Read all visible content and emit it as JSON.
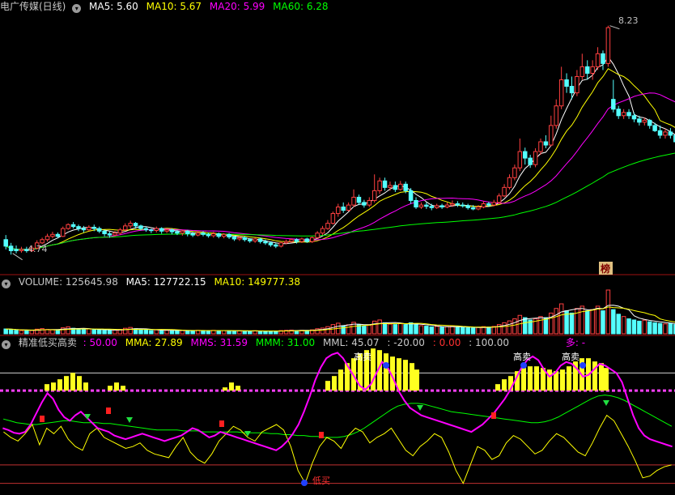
{
  "title": "电广传媒(日线)",
  "ma_header": {
    "ma5": "MA5: 5.60",
    "ma10": "MA10: 5.67",
    "ma20": "MA20: 5.99",
    "ma60": "MA60: 6.28"
  },
  "price_labels": {
    "high": "8.23",
    "low": "4.74",
    "badge": "榜"
  },
  "volume_header": {
    "volume": "VOLUME: 125645.98",
    "ma5": "MA5: 127722.15",
    "ma10": "MA10: 149777.38"
  },
  "indicator_header": {
    "name": "精准低买高卖",
    "v1": ": 50.00",
    "mma": "MMA: 27.89",
    "mms": "MMS: 31.59",
    "mmm": "MMM: 31.00",
    "mml": "MML: 45.07",
    "v2": ": -20.00",
    "v3": ": 0.00",
    "v4": ": 100.00",
    "duo": "多: -"
  },
  "signal_labels": {
    "low_buy": "低买",
    "high_sell": "高卖"
  },
  "colors": {
    "up": "#ff4040",
    "down": "#54ffff",
    "ma5": "#ffffff",
    "ma10": "#ffff00",
    "ma20": "#ff00ff",
    "ma60": "#00ff00",
    "mma": "#ffff00",
    "mms": "#ff00ff",
    "mmm": "#00ff00",
    "separator": "#a01010",
    "text_gray": "#c0c0c0"
  },
  "chart_data": {
    "type": "candlestick",
    "symbol": "电广传媒",
    "period": "日线",
    "price_range": [
      4.5,
      8.4
    ],
    "high_mark": 8.23,
    "low_mark": 4.74,
    "candles": [
      [
        4.95,
        4.85,
        5.02,
        4.8
      ],
      [
        4.85,
        4.78,
        4.9,
        4.72
      ],
      [
        4.8,
        4.78,
        4.86,
        4.74
      ],
      [
        4.78,
        4.8,
        4.84,
        4.75
      ],
      [
        4.8,
        4.78,
        4.84,
        4.75
      ],
      [
        4.78,
        4.82,
        4.86,
        4.76
      ],
      [
        4.82,
        4.9,
        4.94,
        4.8
      ],
      [
        4.9,
        4.95,
        4.98,
        4.88
      ],
      [
        4.95,
        5.0,
        5.04,
        4.92
      ],
      [
        5.0,
        5.03,
        5.07,
        4.97
      ],
      [
        5.03,
        5.0,
        5.06,
        4.97
      ],
      [
        5.0,
        5.12,
        5.15,
        4.99
      ],
      [
        5.12,
        5.18,
        5.2,
        5.1
      ],
      [
        5.18,
        5.15,
        5.22,
        5.12
      ],
      [
        5.15,
        5.12,
        5.18,
        5.08
      ],
      [
        5.12,
        5.1,
        5.16,
        5.06
      ],
      [
        5.1,
        5.14,
        5.17,
        5.08
      ],
      [
        5.14,
        5.12,
        5.18,
        5.08
      ],
      [
        5.12,
        5.08,
        5.15,
        5.05
      ],
      [
        5.08,
        5.04,
        5.1,
        5.0
      ],
      [
        5.04,
        5.02,
        5.07,
        4.98
      ],
      [
        5.02,
        5.05,
        5.08,
        5.0
      ],
      [
        5.05,
        5.1,
        5.13,
        5.02
      ],
      [
        5.1,
        5.16,
        5.2,
        5.08
      ],
      [
        5.16,
        5.2,
        5.24,
        5.12
      ],
      [
        5.2,
        5.16,
        5.22,
        5.12
      ],
      [
        5.16,
        5.12,
        5.18,
        5.09
      ],
      [
        5.12,
        5.1,
        5.15,
        5.07
      ],
      [
        5.1,
        5.09,
        5.12,
        5.05
      ],
      [
        5.09,
        5.12,
        5.15,
        5.06
      ],
      [
        5.12,
        5.08,
        5.14,
        5.04
      ],
      [
        5.08,
        5.1,
        5.12,
        5.05
      ],
      [
        5.1,
        5.07,
        5.12,
        5.03
      ],
      [
        5.07,
        5.05,
        5.1,
        5.02
      ],
      [
        5.05,
        5.08,
        5.1,
        5.01
      ],
      [
        5.08,
        5.04,
        5.1,
        5.0
      ],
      [
        5.04,
        5.02,
        5.07,
        4.99
      ],
      [
        5.02,
        5.05,
        5.08,
        5.0
      ],
      [
        5.05,
        5.03,
        5.08,
        5.0
      ],
      [
        5.03,
        5.01,
        5.06,
        4.98
      ],
      [
        5.01,
        5.04,
        5.07,
        4.98
      ],
      [
        5.04,
        5.0,
        5.06,
        4.97
      ],
      [
        5.0,
        5.03,
        5.05,
        4.97
      ],
      [
        5.03,
        4.99,
        5.05,
        4.96
      ],
      [
        4.99,
        4.96,
        5.01,
        4.93
      ],
      [
        4.96,
        4.98,
        5.0,
        4.93
      ],
      [
        4.98,
        4.95,
        5.0,
        4.92
      ],
      [
        4.95,
        4.93,
        4.97,
        4.9
      ],
      [
        4.93,
        4.96,
        4.98,
        4.9
      ],
      [
        4.96,
        4.92,
        4.98,
        4.89
      ],
      [
        4.92,
        4.9,
        4.95,
        4.87
      ],
      [
        4.9,
        4.87,
        4.92,
        4.84
      ],
      [
        4.87,
        4.85,
        4.9,
        4.82
      ],
      [
        4.85,
        4.9,
        4.92,
        4.83
      ],
      [
        4.9,
        4.92,
        4.95,
        4.88
      ],
      [
        4.92,
        4.95,
        4.97,
        4.9
      ],
      [
        4.95,
        4.92,
        4.97,
        4.89
      ],
      [
        4.92,
        4.96,
        4.98,
        4.9
      ],
      [
        4.96,
        4.92,
        4.98,
        4.9
      ],
      [
        4.92,
        4.98,
        5.0,
        4.9
      ],
      [
        4.98,
        5.05,
        5.08,
        4.96
      ],
      [
        5.05,
        5.12,
        5.16,
        5.02
      ],
      [
        5.12,
        5.2,
        5.25,
        5.1
      ],
      [
        5.2,
        5.35,
        5.38,
        5.18
      ],
      [
        5.35,
        5.45,
        5.5,
        5.3
      ],
      [
        5.45,
        5.4,
        5.52,
        5.36
      ],
      [
        5.4,
        5.48,
        5.52,
        5.38
      ],
      [
        5.48,
        5.6,
        5.72,
        5.45
      ],
      [
        5.6,
        5.52,
        5.64,
        5.48
      ],
      [
        5.52,
        5.48,
        5.56,
        5.44
      ],
      [
        5.48,
        5.55,
        5.6,
        5.45
      ],
      [
        5.55,
        5.7,
        5.95,
        5.52
      ],
      [
        5.7,
        5.85,
        5.9,
        5.65
      ],
      [
        5.85,
        5.75,
        5.9,
        5.7
      ],
      [
        5.75,
        5.78,
        5.84,
        5.7
      ],
      [
        5.78,
        5.72,
        5.84,
        5.68
      ],
      [
        5.72,
        5.8,
        5.85,
        5.7
      ],
      [
        5.8,
        5.7,
        5.84,
        5.66
      ],
      [
        5.7,
        5.55,
        5.74,
        5.5
      ],
      [
        5.55,
        5.45,
        5.6,
        5.42
      ],
      [
        5.45,
        5.48,
        5.52,
        5.42
      ],
      [
        5.48,
        5.46,
        5.52,
        5.42
      ],
      [
        5.46,
        5.44,
        5.5,
        5.4
      ],
      [
        5.44,
        5.47,
        5.5,
        5.42
      ],
      [
        5.47,
        5.45,
        5.5,
        5.42
      ],
      [
        5.45,
        5.48,
        5.52,
        5.43
      ],
      [
        5.48,
        5.5,
        5.55,
        5.45
      ],
      [
        5.5,
        5.48,
        5.54,
        5.45
      ],
      [
        5.48,
        5.47,
        5.52,
        5.44
      ],
      [
        5.47,
        5.44,
        5.5,
        5.41
      ],
      [
        5.44,
        5.42,
        5.48,
        5.4
      ],
      [
        5.42,
        5.45,
        5.48,
        5.4
      ],
      [
        5.45,
        5.5,
        5.54,
        5.43
      ],
      [
        5.5,
        5.48,
        5.53,
        5.45
      ],
      [
        5.48,
        5.52,
        5.56,
        5.46
      ],
      [
        5.52,
        5.62,
        5.66,
        5.5
      ],
      [
        5.62,
        5.75,
        5.8,
        5.6
      ],
      [
        5.75,
        5.9,
        5.95,
        5.72
      ],
      [
        5.9,
        6.05,
        6.1,
        5.86
      ],
      [
        6.05,
        6.3,
        6.5,
        6.0
      ],
      [
        6.3,
        6.2,
        6.36,
        6.1
      ],
      [
        6.2,
        6.1,
        6.25,
        6.05
      ],
      [
        6.1,
        6.3,
        6.35,
        6.06
      ],
      [
        6.3,
        6.45,
        6.5,
        6.25
      ],
      [
        6.45,
        6.4,
        6.55,
        6.35
      ],
      [
        6.4,
        6.7,
        6.85,
        6.38
      ],
      [
        6.7,
        7.0,
        7.1,
        6.65
      ],
      [
        7.0,
        7.4,
        7.6,
        6.95
      ],
      [
        7.4,
        7.3,
        7.5,
        7.2
      ],
      [
        7.3,
        7.2,
        7.45,
        7.1
      ],
      [
        7.2,
        7.45,
        7.55,
        7.15
      ],
      [
        7.45,
        7.6,
        7.8,
        7.4
      ],
      [
        7.6,
        7.5,
        7.7,
        7.4
      ],
      [
        7.5,
        7.6,
        7.7,
        7.4
      ],
      [
        7.6,
        7.8,
        7.9,
        7.55
      ],
      [
        7.8,
        7.65,
        7.85,
        7.55
      ],
      [
        7.65,
        8.2,
        8.23,
        7.6
      ],
      [
        7.1,
        6.95,
        7.4,
        6.9
      ],
      [
        6.95,
        6.85,
        7.0,
        6.8
      ],
      [
        6.85,
        6.9,
        6.95,
        6.8
      ],
      [
        6.9,
        6.85,
        6.95,
        6.8
      ],
      [
        6.85,
        6.8,
        6.9,
        6.75
      ],
      [
        6.8,
        6.75,
        6.85,
        6.7
      ],
      [
        6.75,
        6.78,
        6.82,
        6.7
      ],
      [
        6.78,
        6.7,
        6.8,
        6.65
      ],
      [
        6.7,
        6.62,
        6.74,
        6.6
      ],
      [
        6.62,
        6.55,
        6.7,
        6.5
      ],
      [
        6.55,
        6.6,
        6.65,
        6.5
      ],
      [
        6.6,
        6.55,
        6.66,
        6.5
      ],
      [
        6.55,
        6.45,
        6.6,
        6.4
      ]
    ],
    "ma_series": [
      {
        "name": "MA5",
        "value": 5.6
      },
      {
        "name": "MA10",
        "value": 5.67
      },
      {
        "name": "MA20",
        "value": 5.99
      },
      {
        "name": "MA60",
        "value": 6.28
      }
    ],
    "volume": {
      "name": "VOLUME",
      "last": 125645.98,
      "ma5": 127722.15,
      "ma10": 149777.38,
      "range": [
        0,
        380000
      ],
      "values": [
        42,
        38,
        30,
        28,
        26,
        30,
        40,
        45,
        38,
        34,
        30,
        52,
        60,
        48,
        40,
        36,
        42,
        38,
        34,
        30,
        28,
        32,
        38,
        48,
        55,
        44,
        36,
        32,
        28,
        34,
        30,
        30,
        28,
        26,
        30,
        28,
        26,
        30,
        28,
        26,
        30,
        26,
        28,
        26,
        24,
        26,
        24,
        22,
        26,
        24,
        22,
        24,
        22,
        28,
        30,
        32,
        28,
        30,
        28,
        34,
        44,
        50,
        62,
        80,
        92,
        70,
        78,
        100,
        80,
        66,
        74,
        110,
        120,
        96,
        84,
        80,
        90,
        80,
        96,
        80,
        70,
        66,
        60,
        64,
        58,
        62,
        66,
        60,
        56,
        52,
        50,
        56,
        62,
        58,
        64,
        80,
        96,
        112,
        130,
        160,
        140,
        120,
        130,
        150,
        140,
        180,
        220,
        260,
        200,
        180,
        220,
        240,
        200,
        210,
        240,
        200,
        380,
        210,
        170,
        150,
        130,
        120,
        110,
        118,
        104,
        96,
        90,
        86,
        88,
        80
      ]
    },
    "indicator": {
      "name": "精准低买高卖",
      "reference_lines": [
        {
          "label": "v1",
          "value": 50.0
        },
        {
          "label": "v2",
          "value": -20.0
        },
        {
          "label": "v3",
          "value": 0.0
        },
        {
          "label": "v4",
          "value": 100.0
        }
      ],
      "y_range": [
        -30,
        125
      ],
      "mma_last": 27.89,
      "mms_last": 31.59,
      "mmm_last": 31.0,
      "mml_last": 45.07,
      "mms": [
        40,
        38,
        35,
        34,
        36,
        44,
        56,
        68,
        78,
        72,
        60,
        52,
        48,
        54,
        58,
        52,
        46,
        40,
        38,
        36,
        32,
        30,
        28,
        30,
        32,
        34,
        32,
        30,
        28,
        26,
        28,
        30,
        32,
        36,
        40,
        38,
        34,
        30,
        32,
        36,
        34,
        32,
        30,
        28,
        26,
        24,
        22,
        20,
        18,
        16,
        20,
        26,
        34,
        44,
        58,
        74,
        92,
        106,
        116,
        120,
        122,
        116,
        106,
        96,
        86,
        82,
        88,
        100,
        112,
        106,
        94,
        80,
        70,
        62,
        58,
        54,
        52,
        50,
        48,
        46,
        44,
        42,
        40,
        38,
        36,
        40,
        44,
        50,
        56,
        64,
        72,
        82,
        94,
        106,
        114,
        118,
        114,
        104,
        96,
        100,
        108,
        112,
        110,
        104,
        96,
        98,
        104,
        110,
        108,
        104,
        100,
        90,
        72,
        54,
        40,
        32,
        28,
        26,
        24,
        22,
        20
      ],
      "mma": [
        36,
        30,
        26,
        34,
        44,
        22,
        40,
        34,
        42,
        28,
        20,
        16,
        34,
        40,
        30,
        26,
        22,
        18,
        20,
        24,
        16,
        12,
        10,
        8,
        20,
        30,
        14,
        6,
        2,
        12,
        26,
        34,
        42,
        38,
        30,
        26,
        36,
        40,
        44,
        38,
        20,
        -6,
        -20,
        2,
        20,
        30,
        26,
        18,
        32,
        40,
        36,
        24,
        30,
        34,
        40,
        28,
        16,
        10,
        20,
        26,
        34,
        30,
        14,
        -6,
        -20,
        0,
        20,
        16,
        6,
        10,
        24,
        32,
        28,
        20,
        12,
        16,
        26,
        34,
        30,
        22,
        14,
        10,
        24,
        40,
        54,
        48,
        34,
        20,
        4,
        -14,
        -12,
        -6,
        -2,
        0
      ],
      "mmm": [
        50,
        48,
        46,
        45,
        44,
        44,
        45,
        46,
        47,
        48,
        48,
        47,
        46,
        46,
        46,
        45,
        45,
        44,
        43,
        42,
        41,
        40,
        39,
        38,
        38,
        38,
        38,
        37,
        37,
        37,
        36,
        36,
        36,
        36,
        36,
        36,
        35,
        35,
        35,
        35,
        34,
        34,
        33,
        33,
        32,
        32,
        31,
        31,
        30,
        30,
        30,
        31,
        33,
        36,
        40,
        45,
        50,
        55,
        60,
        64,
        66,
        67,
        67,
        66,
        64,
        62,
        60,
        58,
        57,
        56,
        55,
        54,
        53,
        52,
        51,
        50,
        49,
        48,
        47,
        46,
        46,
        47,
        49,
        52,
        56,
        60,
        64,
        68,
        72,
        75,
        76,
        75,
        73,
        70,
        66,
        62,
        58,
        54,
        50,
        46,
        42
      ],
      "bars": [
        {
          "x": [
            55,
            63,
            71,
            79,
            87,
            95,
            103
          ],
          "h": [
            8,
            10,
            14,
            18,
            22,
            18,
            10
          ]
        },
        {
          "x": [
            133,
            141,
            149
          ],
          "h": [
            6,
            10,
            6
          ]
        },
        {
          "x": [
            275,
            283,
            291
          ],
          "h": [
            4,
            10,
            6
          ]
        },
        {
          "x": [
            402,
            410,
            418,
            426,
            434,
            442,
            450,
            458,
            466,
            474,
            482,
            490,
            498,
            506,
            512
          ],
          "h": [
            12,
            18,
            26,
            34,
            40,
            46,
            50,
            52,
            50,
            46,
            42,
            40,
            38,
            34,
            26
          ]
        },
        {
          "x": [
            612,
            620,
            628,
            636,
            644,
            652,
            660,
            668,
            676,
            684,
            692,
            700,
            708,
            716,
            724,
            732,
            740,
            746
          ],
          "h": [
            8,
            14,
            18,
            24,
            28,
            30,
            30,
            28,
            26,
            24,
            26,
            30,
            36,
            40,
            40,
            36,
            34,
            28
          ]
        }
      ]
    },
    "signals": [
      {
        "type": "buy",
        "label": "低买",
        "idx": 0
      },
      {
        "type": "sell",
        "label": "高卖",
        "idx": 1
      },
      {
        "type": "sell",
        "label": "高卖",
        "idx": 2
      },
      {
        "type": "sell",
        "label": "高卖",
        "idx": 3
      }
    ]
  }
}
